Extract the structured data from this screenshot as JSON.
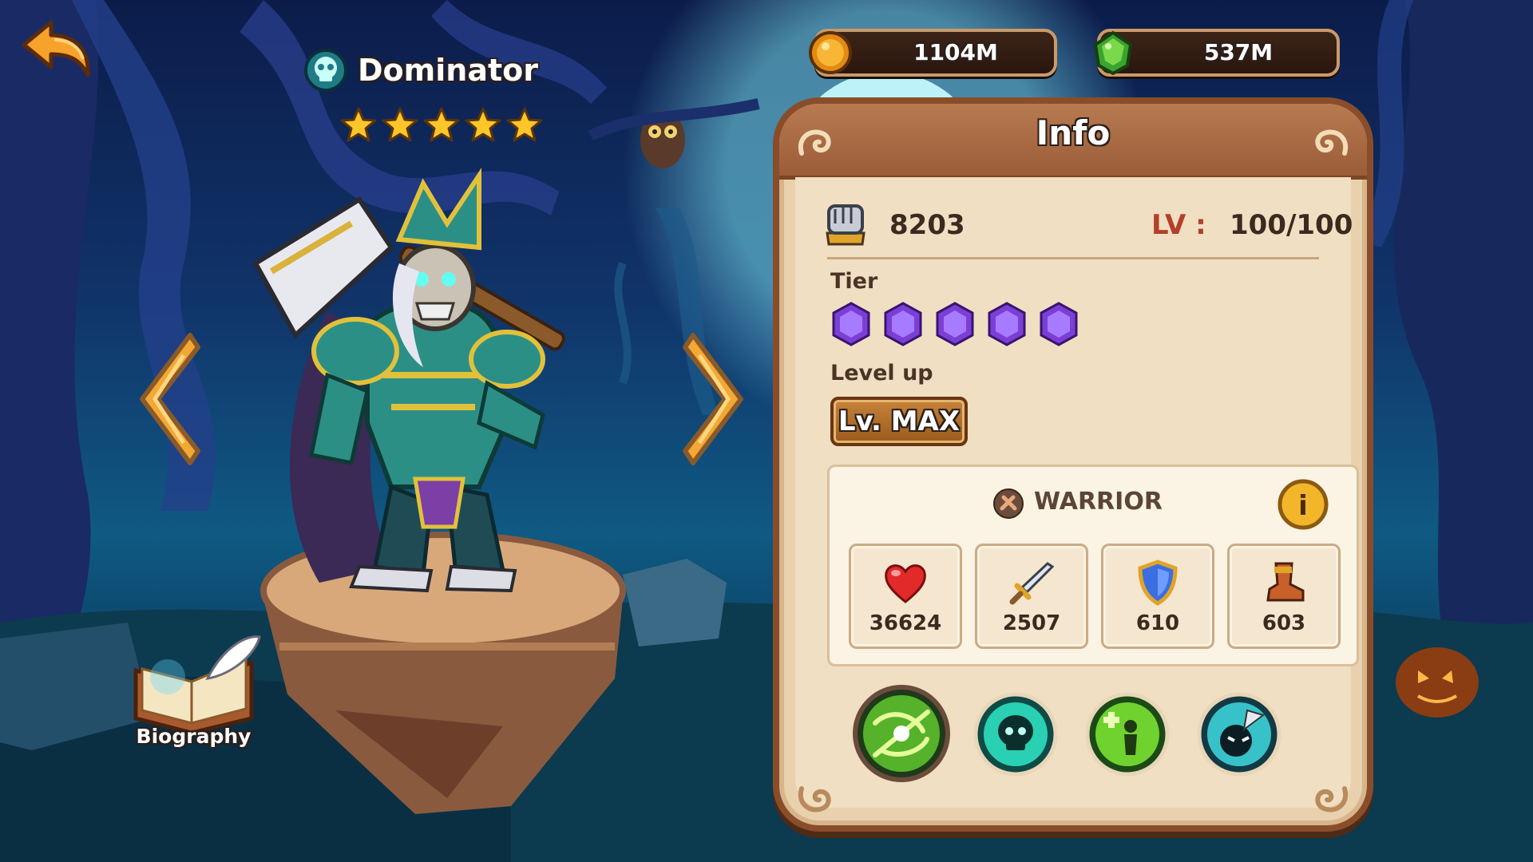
{
  "hero": {
    "name": "Dominator",
    "stars": 5,
    "faction_icon": "skull-icon"
  },
  "currency": {
    "gold": "1104M",
    "gems": "537M"
  },
  "biography": {
    "label": "Biography"
  },
  "info": {
    "title": "Info",
    "power": "8203",
    "level_label": "LV :",
    "level_value": "100/100",
    "tier_label": "Tier",
    "tier_gems": 5,
    "level_up_label": "Level up",
    "level_button": "Lv. MAX",
    "class_name": "WARRIOR",
    "info_button": "i",
    "stats": [
      {
        "name": "health",
        "icon": "heart-icon",
        "value": "36624"
      },
      {
        "name": "attack",
        "icon": "sword-icon",
        "value": "2507"
      },
      {
        "name": "armor",
        "icon": "shield-icon",
        "value": "610"
      },
      {
        "name": "speed",
        "icon": "boot-icon",
        "value": "603"
      }
    ],
    "skills": [
      {
        "name": "vortex-skill-icon"
      },
      {
        "name": "skull-skill-icon"
      },
      {
        "name": "heal-skill-icon"
      },
      {
        "name": "strike-skill-icon"
      }
    ]
  },
  "colors": {
    "panel_border": "#8a4d2a",
    "panel_bg": "#e9d1ae",
    "level_label": "#b2402a",
    "tier_gem": "#7b3fd6"
  }
}
